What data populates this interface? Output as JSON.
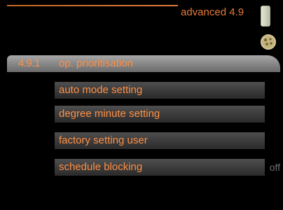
{
  "header": {
    "title": "advanced 4.9",
    "icons": [
      "thermometer-icon",
      "cookie-icon"
    ]
  },
  "menu": {
    "selected_number": "4.9.1",
    "items": [
      {
        "label": "op. prioritisation"
      },
      {
        "label": "auto mode setting"
      },
      {
        "label": "degree minute setting"
      },
      {
        "label": "factory setting user"
      },
      {
        "label": "schedule blocking",
        "value": "off"
      }
    ]
  },
  "colors": {
    "accent": "#ff8f45",
    "header_title": "#e57a3a",
    "selected_bar": "#8b8b8b",
    "row_bg": "#3a3a3a",
    "value_text": "#6f6f6f",
    "background": "#000000"
  }
}
